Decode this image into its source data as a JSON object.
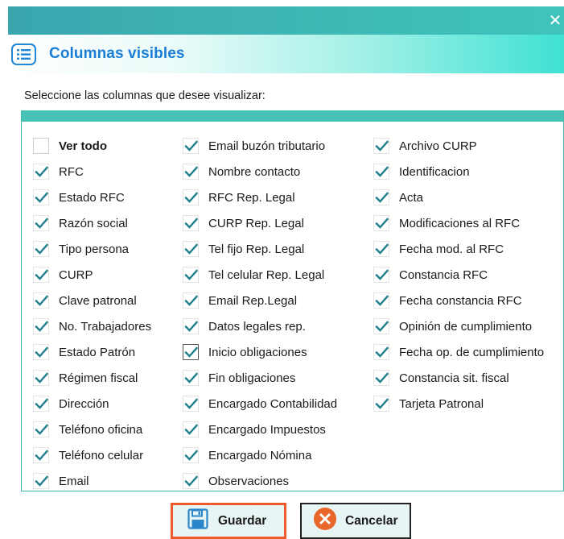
{
  "window": {
    "close_glyph": "✕"
  },
  "dialog": {
    "title": "Columnas visibles",
    "title_icon": "list-icon",
    "prompt": "Seleccione las columnas que desee visualizar:"
  },
  "columns": [
    [
      {
        "label": "Ver todo",
        "checked": false,
        "bold": true
      },
      {
        "label": "RFC",
        "checked": true
      },
      {
        "label": "Estado RFC",
        "checked": true
      },
      {
        "label": "Razón social",
        "checked": true
      },
      {
        "label": "Tipo persona",
        "checked": true
      },
      {
        "label": "CURP",
        "checked": true
      },
      {
        "label": "Clave patronal",
        "checked": true
      },
      {
        "label": "No. Trabajadores",
        "checked": true
      },
      {
        "label": "Estado Patrón",
        "checked": true
      },
      {
        "label": "Régimen fiscal",
        "checked": true
      },
      {
        "label": "Dirección",
        "checked": true
      },
      {
        "label": "Teléfono oficina",
        "checked": true
      },
      {
        "label": "Teléfono celular",
        "checked": true
      },
      {
        "label": "Email",
        "checked": true
      }
    ],
    [
      {
        "label": "Email buzón tributario",
        "checked": true
      },
      {
        "label": "Nombre contacto",
        "checked": true
      },
      {
        "label": "RFC Rep. Legal",
        "checked": true
      },
      {
        "label": "CURP Rep. Legal",
        "checked": true
      },
      {
        "label": "Tel fijo Rep. Legal",
        "checked": true
      },
      {
        "label": "Tel celular Rep. Legal",
        "checked": true
      },
      {
        "label": "Email Rep.Legal",
        "checked": true
      },
      {
        "label": "Datos legales rep.",
        "checked": true
      },
      {
        "label": "Inicio obligaciones",
        "checked": true,
        "focused": true
      },
      {
        "label": "Fin obligaciones",
        "checked": true
      },
      {
        "label": "Encargado Contabilidad",
        "checked": true
      },
      {
        "label": "Encargado Impuestos",
        "checked": true
      },
      {
        "label": "Encargado Nómina",
        "checked": true
      },
      {
        "label": "Observaciones",
        "checked": true
      }
    ],
    [
      {
        "label": "Archivo CURP",
        "checked": true
      },
      {
        "label": "Identificacion",
        "checked": true
      },
      {
        "label": "Acta",
        "checked": true
      },
      {
        "label": "Modificaciones al RFC",
        "checked": true
      },
      {
        "label": "Fecha mod. al RFC",
        "checked": true
      },
      {
        "label": "Constancia RFC",
        "checked": true
      },
      {
        "label": "Fecha constancia RFC",
        "checked": true
      },
      {
        "label": "Opinión de cumplimiento",
        "checked": true
      },
      {
        "label": "Fecha op. de cumplimiento",
        "checked": true
      },
      {
        "label": "Constancia sit. fiscal",
        "checked": true
      },
      {
        "label": "Tarjeta Patronal",
        "checked": true
      }
    ]
  ],
  "buttons": {
    "save_label": "Guardar",
    "save_icon": "floppy-disk-icon",
    "cancel_label": "Cancelar",
    "cancel_icon": "cancel-circle-icon"
  },
  "colors": {
    "accent_blue": "#1a7ed6",
    "checkmark": "#1f7f8c",
    "teal": "#46c3b6",
    "save_border": "#ef5a2a",
    "cancel_orange": "#e9662a"
  }
}
